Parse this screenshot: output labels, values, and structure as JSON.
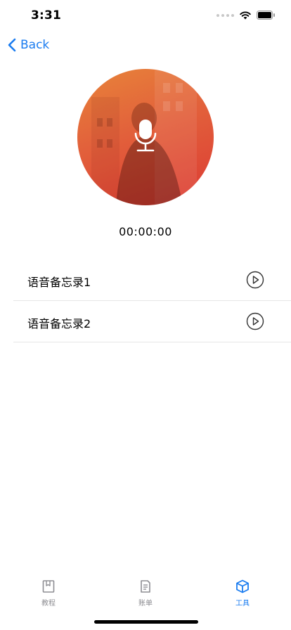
{
  "status_bar": {
    "time": "3:31"
  },
  "nav": {
    "back_label": "Back"
  },
  "recorder": {
    "timer": "00:00:00"
  },
  "memos": [
    {
      "label": "语音备忘录1"
    },
    {
      "label": "语音备忘录2"
    }
  ],
  "tab_bar": {
    "items": [
      {
        "label": "教程",
        "icon": "book-icon",
        "active": false
      },
      {
        "label": "账单",
        "icon": "document-icon",
        "active": false
      },
      {
        "label": "工具",
        "icon": "cube-icon",
        "active": true
      }
    ]
  },
  "colors": {
    "accent": "#1a7cf0",
    "inactive_tab": "#8e8e93",
    "gradient_start": "#e8843a",
    "gradient_end": "#dc3a33"
  }
}
